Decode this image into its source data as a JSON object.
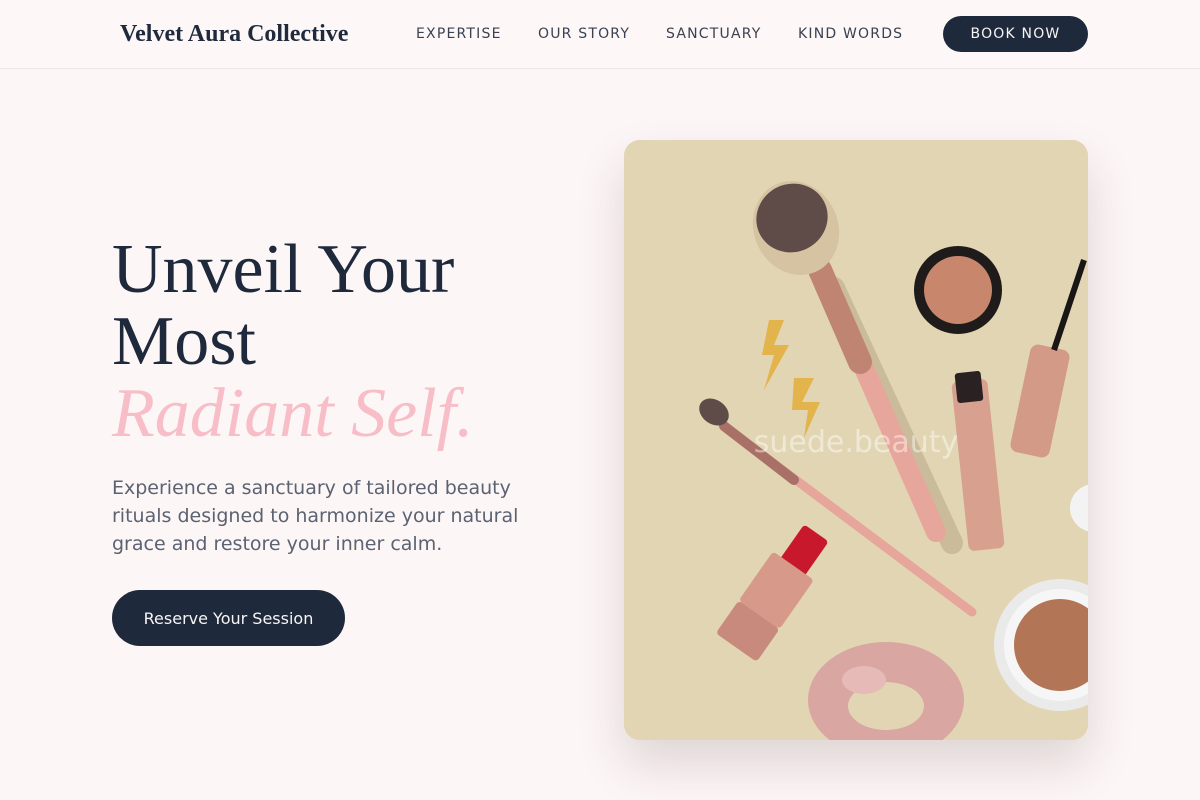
{
  "brand": {
    "name": "Velvet Aura Collective"
  },
  "nav": {
    "links": [
      {
        "label": "EXPERTISE"
      },
      {
        "label": "OUR STORY"
      },
      {
        "label": "SANCTUARY"
      },
      {
        "label": "KIND WORDS"
      }
    ],
    "cta_label": "BOOK NOW"
  },
  "hero": {
    "headline_line1": "Unveil Your",
    "headline_line2": "Most",
    "headline_accent": "Radiant Self.",
    "subtext": "Experience a sanctuary of tailored beauty rituals designed to harmonize your natural grace and restore your inner calm.",
    "cta_label": "Reserve Your Session",
    "image_watermark": "suede.beauty"
  },
  "colors": {
    "page_background": "#fdf6f6",
    "navy": "#1e293b",
    "accent_pink": "#f7bec8",
    "body_text": "#5b6272",
    "image_background": "#e2d5b3"
  },
  "icons": {
    "image_subject": "makeup-flatlay-image"
  }
}
